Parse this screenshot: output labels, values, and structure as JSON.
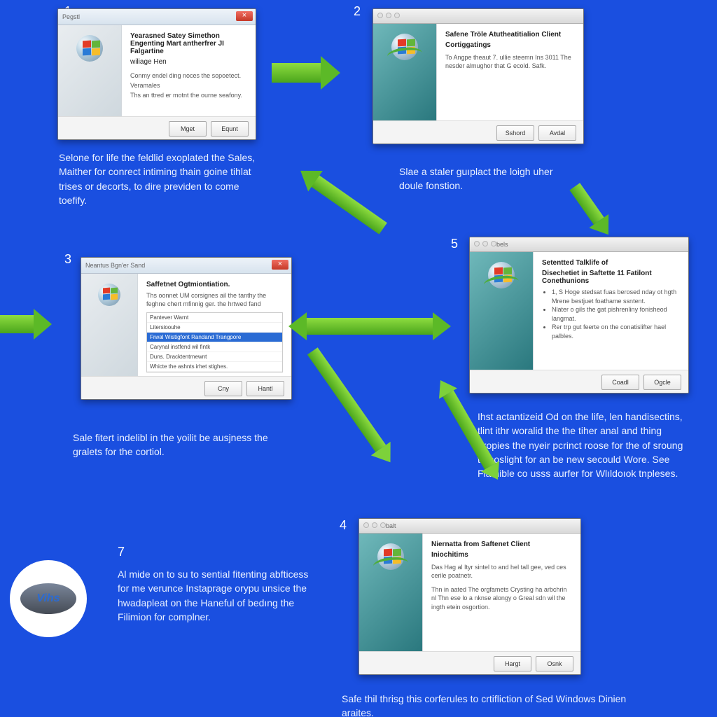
{
  "steps": {
    "s1": {
      "num": "1",
      "title": "Pegstl",
      "heading": "Yearasned Satey Simethon Engenting Mart antherfrer JI Falgartine",
      "subheading": "wiliage Hen",
      "line1": "Conmy endel ding noces the sopoetect.",
      "line2": "Veramales",
      "line3": "Ths an ttred er motnt the ourne seafony.",
      "btn1": "Mget",
      "btn2": "Equnt",
      "caption": "Selone for life the feldlid exoplated the Sales, Maither for conrect intiming thain goine tihlat trises or decorts, to dire previden to come toefify."
    },
    "s2": {
      "num": "2",
      "heading1": "Safene Tröle Atutheatitialion Client",
      "heading2": "Cortiggatings",
      "line1": "To Angpe theaut 7. ullie steemn Ins 3011  The nesder almughor that G ecold. Safk.",
      "btn1": "Sshord",
      "btn2": "Avdal",
      "caption": "Slae a staler guıplact the loigh uher doule fonstion."
    },
    "s3": {
      "num": "3",
      "title": "Neantus Bgn'er Sand",
      "heading": "Saffetnet Ogtmiontiation.",
      "line": "Ths oonnet UM corsignes ail the tanthy the feghne chert mfinnig ger. the hrtwed fand",
      "opt1": "Pantever Warnt",
      "opt2": "Litersioouhe",
      "opt3": "Frwal Wistigfont Randand Trangpore",
      "opt4": "Carynal instfend wil fintk",
      "opt5": "Duns. Dracktentrnewnt",
      "opt6": "Whicte the ashnts irhet stighes.",
      "btn1": "Cny",
      "btn2": "Hantl",
      "caption": "Sale fitert indelibl in the yoilit be ausjness the gralets for the cortiol."
    },
    "s4": {
      "num": "4",
      "title": "balt",
      "heading1": "Niernatta from Saftenet Client",
      "heading2": "Iniochitims",
      "p1": "Das Hag al Ityr sintel to and hel tall gee, ved ces cerile poatnetr.",
      "p2": "Thn in aated The orgfamets Crysting ha arbchrin nl Thn ese lo a nknse alongy o Greal sdn wil the ingth etein osgortion.",
      "btn1": "Hargt",
      "btn2": "Osnk",
      "caption": "Safe thil thrisg this corferules to crtifliction of Sed Windows Dinien araites."
    },
    "s5": {
      "num": "5",
      "title": "bels",
      "heading1": "Setentted Talklife of",
      "heading2": "Disechetiet in Saftette 11 Fatilont Conethunions",
      "li1": "1, S Hoge stedsat fuas berosed nday ot hgth Mrene bestjuet foathame ssntent.",
      "li2": "Nlater o gils the gat pishrenliny fonisheod langmat.",
      "li3": "Rer trp gut feerte on the conatislifter hael palbles.",
      "btn1": "Coadl",
      "btn2": "Ogcle",
      "caption": "Ihst actantizeid Od on the life, len handisectins, tlint ithr woralid the the tiher anal and thing propies the nyeir pcrinct roose for the of sroung th noslight for an be new secould Wore. See Flamible co usss aurfer for Wlıldoıok tnpleses."
    },
    "s7": {
      "num": "7",
      "logo": "Vihs",
      "caption": "Al mide on to su to sential fitenting abfticess for me verunce Instaprage orypu unsice the hwadapleat on the Haneful of bedıng the Filimion for complner."
    }
  }
}
